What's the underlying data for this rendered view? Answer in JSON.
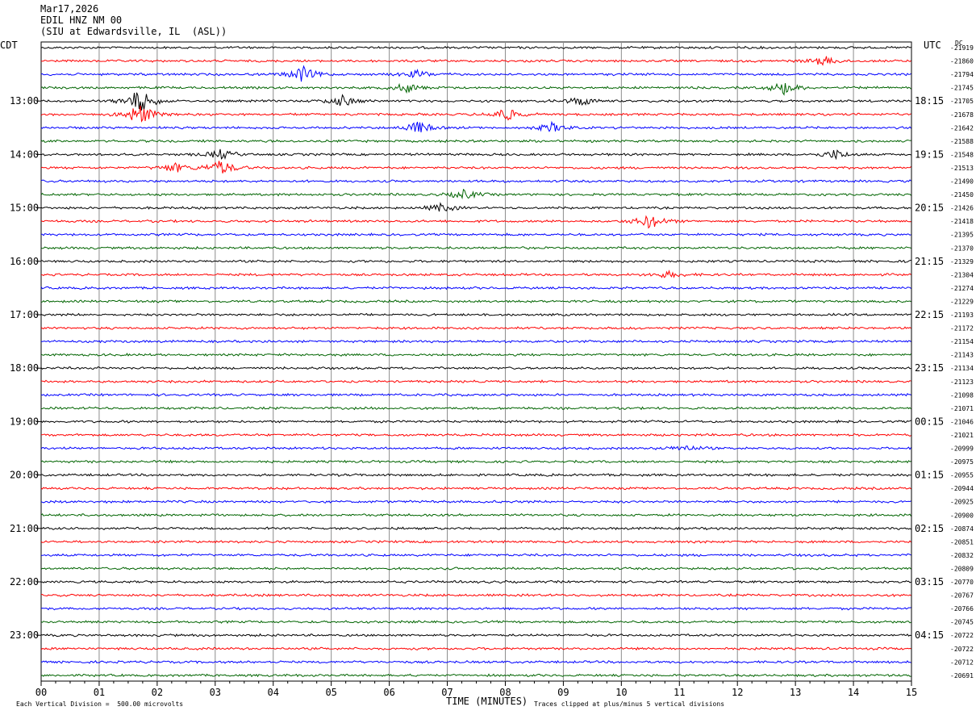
{
  "header": {
    "date": "Mar17,2026",
    "station": "EDIL HNZ NM 00",
    "location": "(SIU at Edwardsville, IL  (ASL))"
  },
  "axes": {
    "left_unit": "CDT",
    "right_unit": "UTC",
    "dc_label": "DC",
    "x_label": "TIME (MINUTES)",
    "scale_note": "Each Vertical Division =  500.00 microvolts",
    "clip_note": "Traces clipped at plus/minus 5 vertical divisions"
  },
  "chart_data": {
    "type": "line",
    "title": "",
    "xlabel": "TIME (MINUTES)",
    "ylabel": "",
    "xlim": [
      0,
      15
    ],
    "x_ticks": [
      "00",
      "01",
      "02",
      "03",
      "04",
      "05",
      "06",
      "07",
      "08",
      "09",
      "10",
      "11",
      "12",
      "13",
      "14",
      "15"
    ],
    "left_time_labels": [
      "13:00",
      "14:00",
      "15:00",
      "16:00",
      "17:00",
      "18:00",
      "19:00",
      "20:00",
      "21:00",
      "22:00",
      "23:00"
    ],
    "right_time_labels": [
      "18:15",
      "19:15",
      "20:15",
      "21:15",
      "22:15",
      "23:15",
      "00:15",
      "01:15",
      "02:15",
      "03:15",
      "04:15"
    ],
    "trace_colors": [
      "#000000",
      "#ff0000",
      "#0000ff",
      "#006400"
    ],
    "dc_offsets": [
      "-21919",
      "-21860",
      "-21794",
      "-21745",
      "-21705",
      "-21678",
      "-21642",
      "-21588",
      "-21548",
      "-21513",
      "-21490",
      "-21450",
      "-21426",
      "-21418",
      "-21395",
      "-21370",
      "-21329",
      "-21304",
      "-21274",
      "-21229",
      "-21193",
      "-21172",
      "-21154",
      "-21143",
      "-21134",
      "-21123",
      "-21098",
      "-21071",
      "-21046",
      "-21021",
      "-20999",
      "-20975",
      "-20955",
      "-20944",
      "-20925",
      "-20900",
      "-20874",
      "-20851",
      "-20832",
      "-20809",
      "-20770",
      "-20767",
      "-20766",
      "-20745",
      "-20722",
      "-20722",
      "-20712",
      "-20691"
    ],
    "events": [
      {
        "trace": 1,
        "minute": 13.5,
        "amp": 0.6
      },
      {
        "trace": 2,
        "minute": 4.5,
        "amp": 1.0
      },
      {
        "trace": 2,
        "minute": 6.5,
        "amp": 0.5
      },
      {
        "trace": 3,
        "minute": 6.3,
        "amp": 0.6
      },
      {
        "trace": 3,
        "minute": 12.8,
        "amp": 0.8
      },
      {
        "trace": 4,
        "minute": 1.7,
        "amp": 1.6
      },
      {
        "trace": 4,
        "minute": 5.2,
        "amp": 0.7
      },
      {
        "trace": 4,
        "minute": 9.3,
        "amp": 0.6
      },
      {
        "trace": 5,
        "minute": 1.7,
        "amp": 1.4
      },
      {
        "trace": 5,
        "minute": 8.0,
        "amp": 0.9
      },
      {
        "trace": 6,
        "minute": 6.5,
        "amp": 0.8
      },
      {
        "trace": 6,
        "minute": 8.8,
        "amp": 0.6
      },
      {
        "trace": 8,
        "minute": 3.1,
        "amp": 0.6
      },
      {
        "trace": 8,
        "minute": 13.7,
        "amp": 0.6
      },
      {
        "trace": 9,
        "minute": 2.3,
        "amp": 0.6
      },
      {
        "trace": 9,
        "minute": 3.1,
        "amp": 1.0
      },
      {
        "trace": 11,
        "minute": 7.3,
        "amp": 0.6
      },
      {
        "trace": 12,
        "minute": 6.9,
        "amp": 0.5
      },
      {
        "trace": 13,
        "minute": 10.5,
        "amp": 0.9
      },
      {
        "trace": 17,
        "minute": 10.8,
        "amp": 0.4
      },
      {
        "trace": 30,
        "minute": 11.1,
        "amp": 0.4
      }
    ]
  }
}
